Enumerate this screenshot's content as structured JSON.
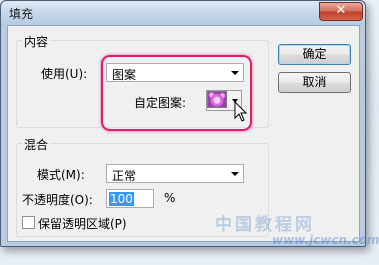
{
  "window": {
    "title": "填充",
    "close_symbol": "✕"
  },
  "content_group": {
    "legend": "内容",
    "use_label": "使用(U):",
    "use_value": "图案",
    "custom_pattern_label": "自定图案:"
  },
  "blend_group": {
    "legend": "混合",
    "mode_label": "模式(M):",
    "mode_value": "正常",
    "opacity_label": "不透明度(O):",
    "opacity_value": "100",
    "opacity_unit": "%",
    "preserve_label": "保留透明区域(P)"
  },
  "buttons": {
    "ok": "确定",
    "cancel": "取消"
  },
  "watermark": {
    "main": "中国教程网",
    "sub": "www.jcwcn.com"
  },
  "colors": {
    "highlight": "#e5196b",
    "accent": "#3399ff",
    "close": "#c0412a"
  }
}
